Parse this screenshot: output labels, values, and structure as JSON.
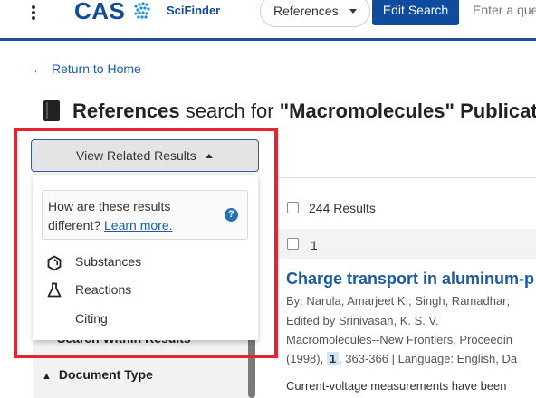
{
  "header": {
    "logo_text": "CAS",
    "product": "SciFinder",
    "search_type": "References",
    "edit_search_label": "Edit Search",
    "query_placeholder": "Enter a que"
  },
  "nav": {
    "return_label": "Return to Home"
  },
  "page": {
    "title_bold": "References",
    "title_middle": " search for ",
    "title_query": "\"Macromolecules\" Publicat"
  },
  "related": {
    "button_label": "View Related Results",
    "info_line1": "How are these results",
    "info_line2_prefix": "different? ",
    "learn_more": "Learn more.",
    "help_icon": "?",
    "items": [
      {
        "label": "Substances",
        "icon": "hexagon-icon"
      },
      {
        "label": "Reactions",
        "icon": "flask-icon"
      },
      {
        "label": "Citing",
        "icon": ""
      }
    ]
  },
  "sidebar": {
    "search_within": "Search Within Results",
    "doc_type": "Document Type"
  },
  "results": {
    "count_label": "244 Results",
    "row_number": "1",
    "title": "Charge transport in aluminum-p",
    "by_line": "By: Narula, Amarjeet K.; Singh, Ramadhar;",
    "edited_line": "Edited by Srinivasan, K. S. V.",
    "source_line": "Macromolecules--New Frontiers, Proceedin",
    "year_prefix": "(1998), ",
    "volume": "1",
    "year_suffix": ", 363-366 | Language: English, Da",
    "abstract": "Current-voltage measurements have been"
  },
  "colors": {
    "brand_blue": "#0f4c9e",
    "link_blue": "#1d5ea8",
    "annotation_red": "#e3262e"
  }
}
